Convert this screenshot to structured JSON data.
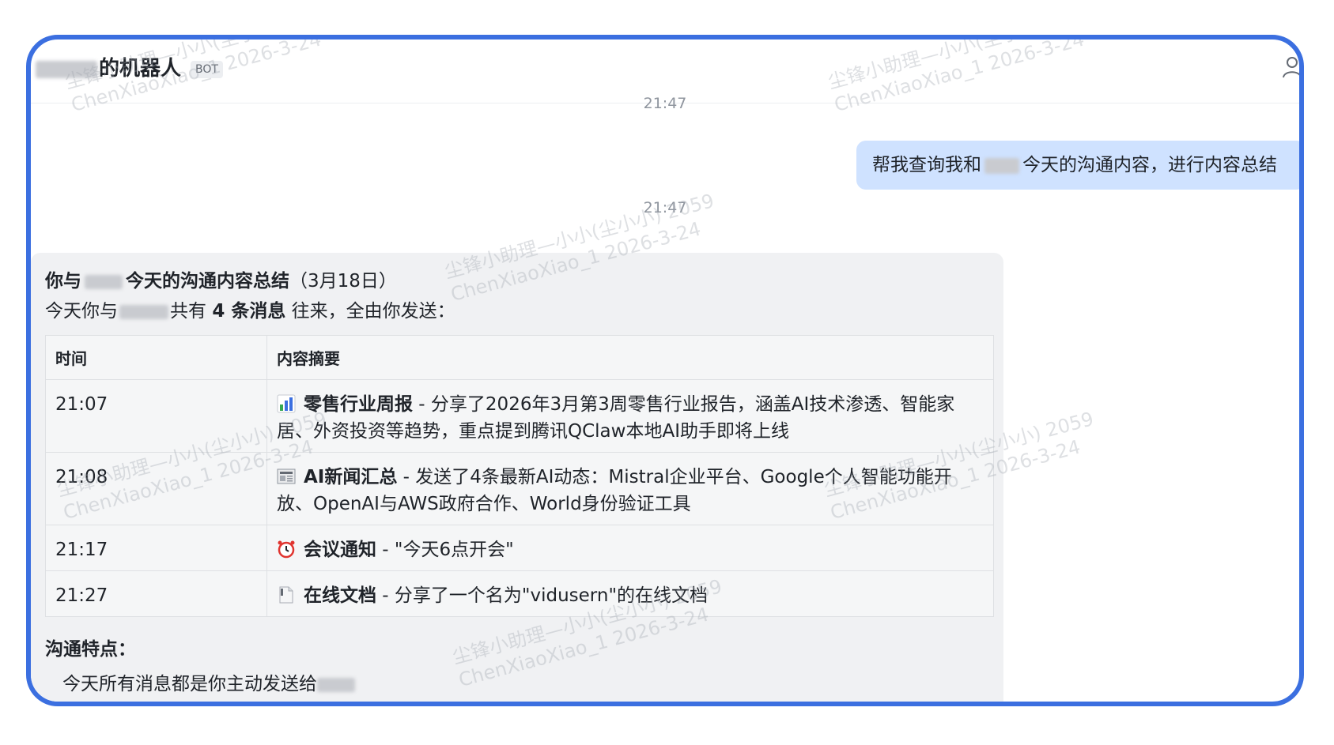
{
  "header": {
    "title": "的机器人",
    "badge": "BOT"
  },
  "messages": {
    "time_1": "21:47",
    "user_msg_pre": "帮我查询我和",
    "user_msg_post": "今天的沟通内容，进行内容总结",
    "time_2": "21:47"
  },
  "bot": {
    "title_pre": "你与",
    "title_bold": "今天的沟通内容总结",
    "title_date": "（3月18日）",
    "intro_pre": "今天你与",
    "intro_mid": "共有",
    "intro_bold": "4 条消息",
    "intro_post": "往来，全由你发送：",
    "table": {
      "headers": [
        "时间",
        "内容摘要"
      ],
      "rows": [
        {
          "time": "21:07",
          "icon": "bar-chart-icon",
          "bold": "零售行业周报",
          "text": " - 分享了2026年3月第3周零售行业报告，涵盖AI技术渗透、智能家居、外资投资等趋势，重点提到腾讯QClaw本地AI助手即将上线"
        },
        {
          "time": "21:08",
          "icon": "newspaper-icon",
          "bold": "AI新闻汇总",
          "text": " - 发送了4条最新AI动态：Mistral企业平台、Google个人智能功能开放、OpenAI与AWS政府合作、World身份验证工具"
        },
        {
          "time": "21:17",
          "icon": "alarm-clock-icon",
          "bold": "会议通知",
          "text": " - \"今天6点开会\""
        },
        {
          "time": "21:27",
          "icon": "document-icon",
          "bold": "在线文档",
          "text": " - 分享了一个名为\"vidusern\"的在线文档"
        }
      ]
    },
    "section_title": "沟通特点：",
    "cut_line": "今天所有消息都是你主动发送给"
  },
  "watermark": {
    "line1": "尘锋小助理—小小(尘小小) 2059",
    "line2": "ChenXiaoXiao_1 2026-3-24"
  },
  "colors": {
    "frame": "#3b6fe0",
    "user_bubble": "#cfe2ff",
    "bot_card": "#f0f1f3"
  }
}
